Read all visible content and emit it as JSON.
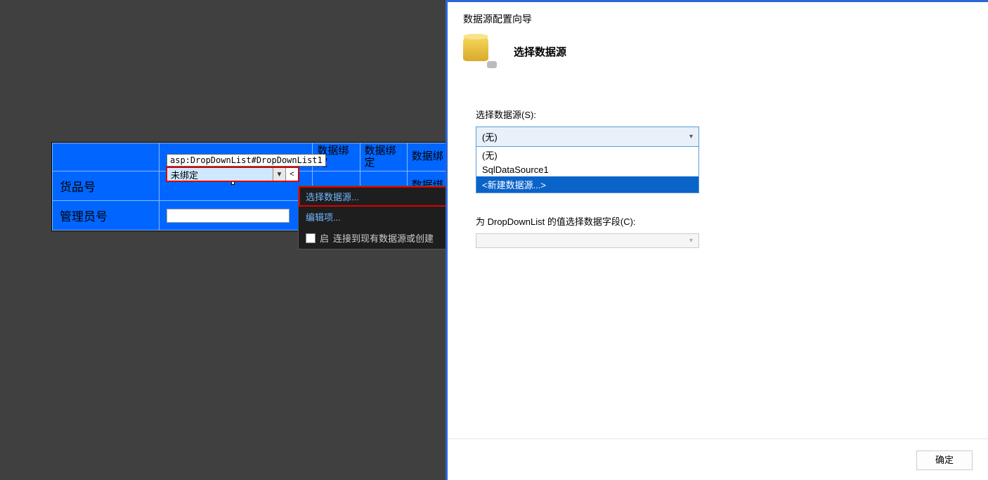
{
  "designer": {
    "control_tag": "asp:DropDownList#DropDownList1",
    "ddl_text": "未绑定",
    "row_headers": {
      "product_id": "货品号",
      "admin_id": "管理员号"
    },
    "bind_cell": "数据绑定",
    "bind_cell_short": "数据绑"
  },
  "smart_tag": {
    "choose_ds": "选择数据源...",
    "edit_items": "编辑项...",
    "enable_chk_prefix": "启",
    "connect_existing": "连接到现有数据源或创建"
  },
  "wizard": {
    "title": "数据源配置向导",
    "heading": "选择数据源",
    "ds_label": "选择数据源(S):",
    "ds_selected": "(无)",
    "ds_options": {
      "none": "(无)",
      "sql": "SqlDataSource1",
      "new": "<新建数据源...>"
    },
    "value_field_label": "为 DropDownList 的值选择数据字段(C):",
    "ok": "确定"
  }
}
